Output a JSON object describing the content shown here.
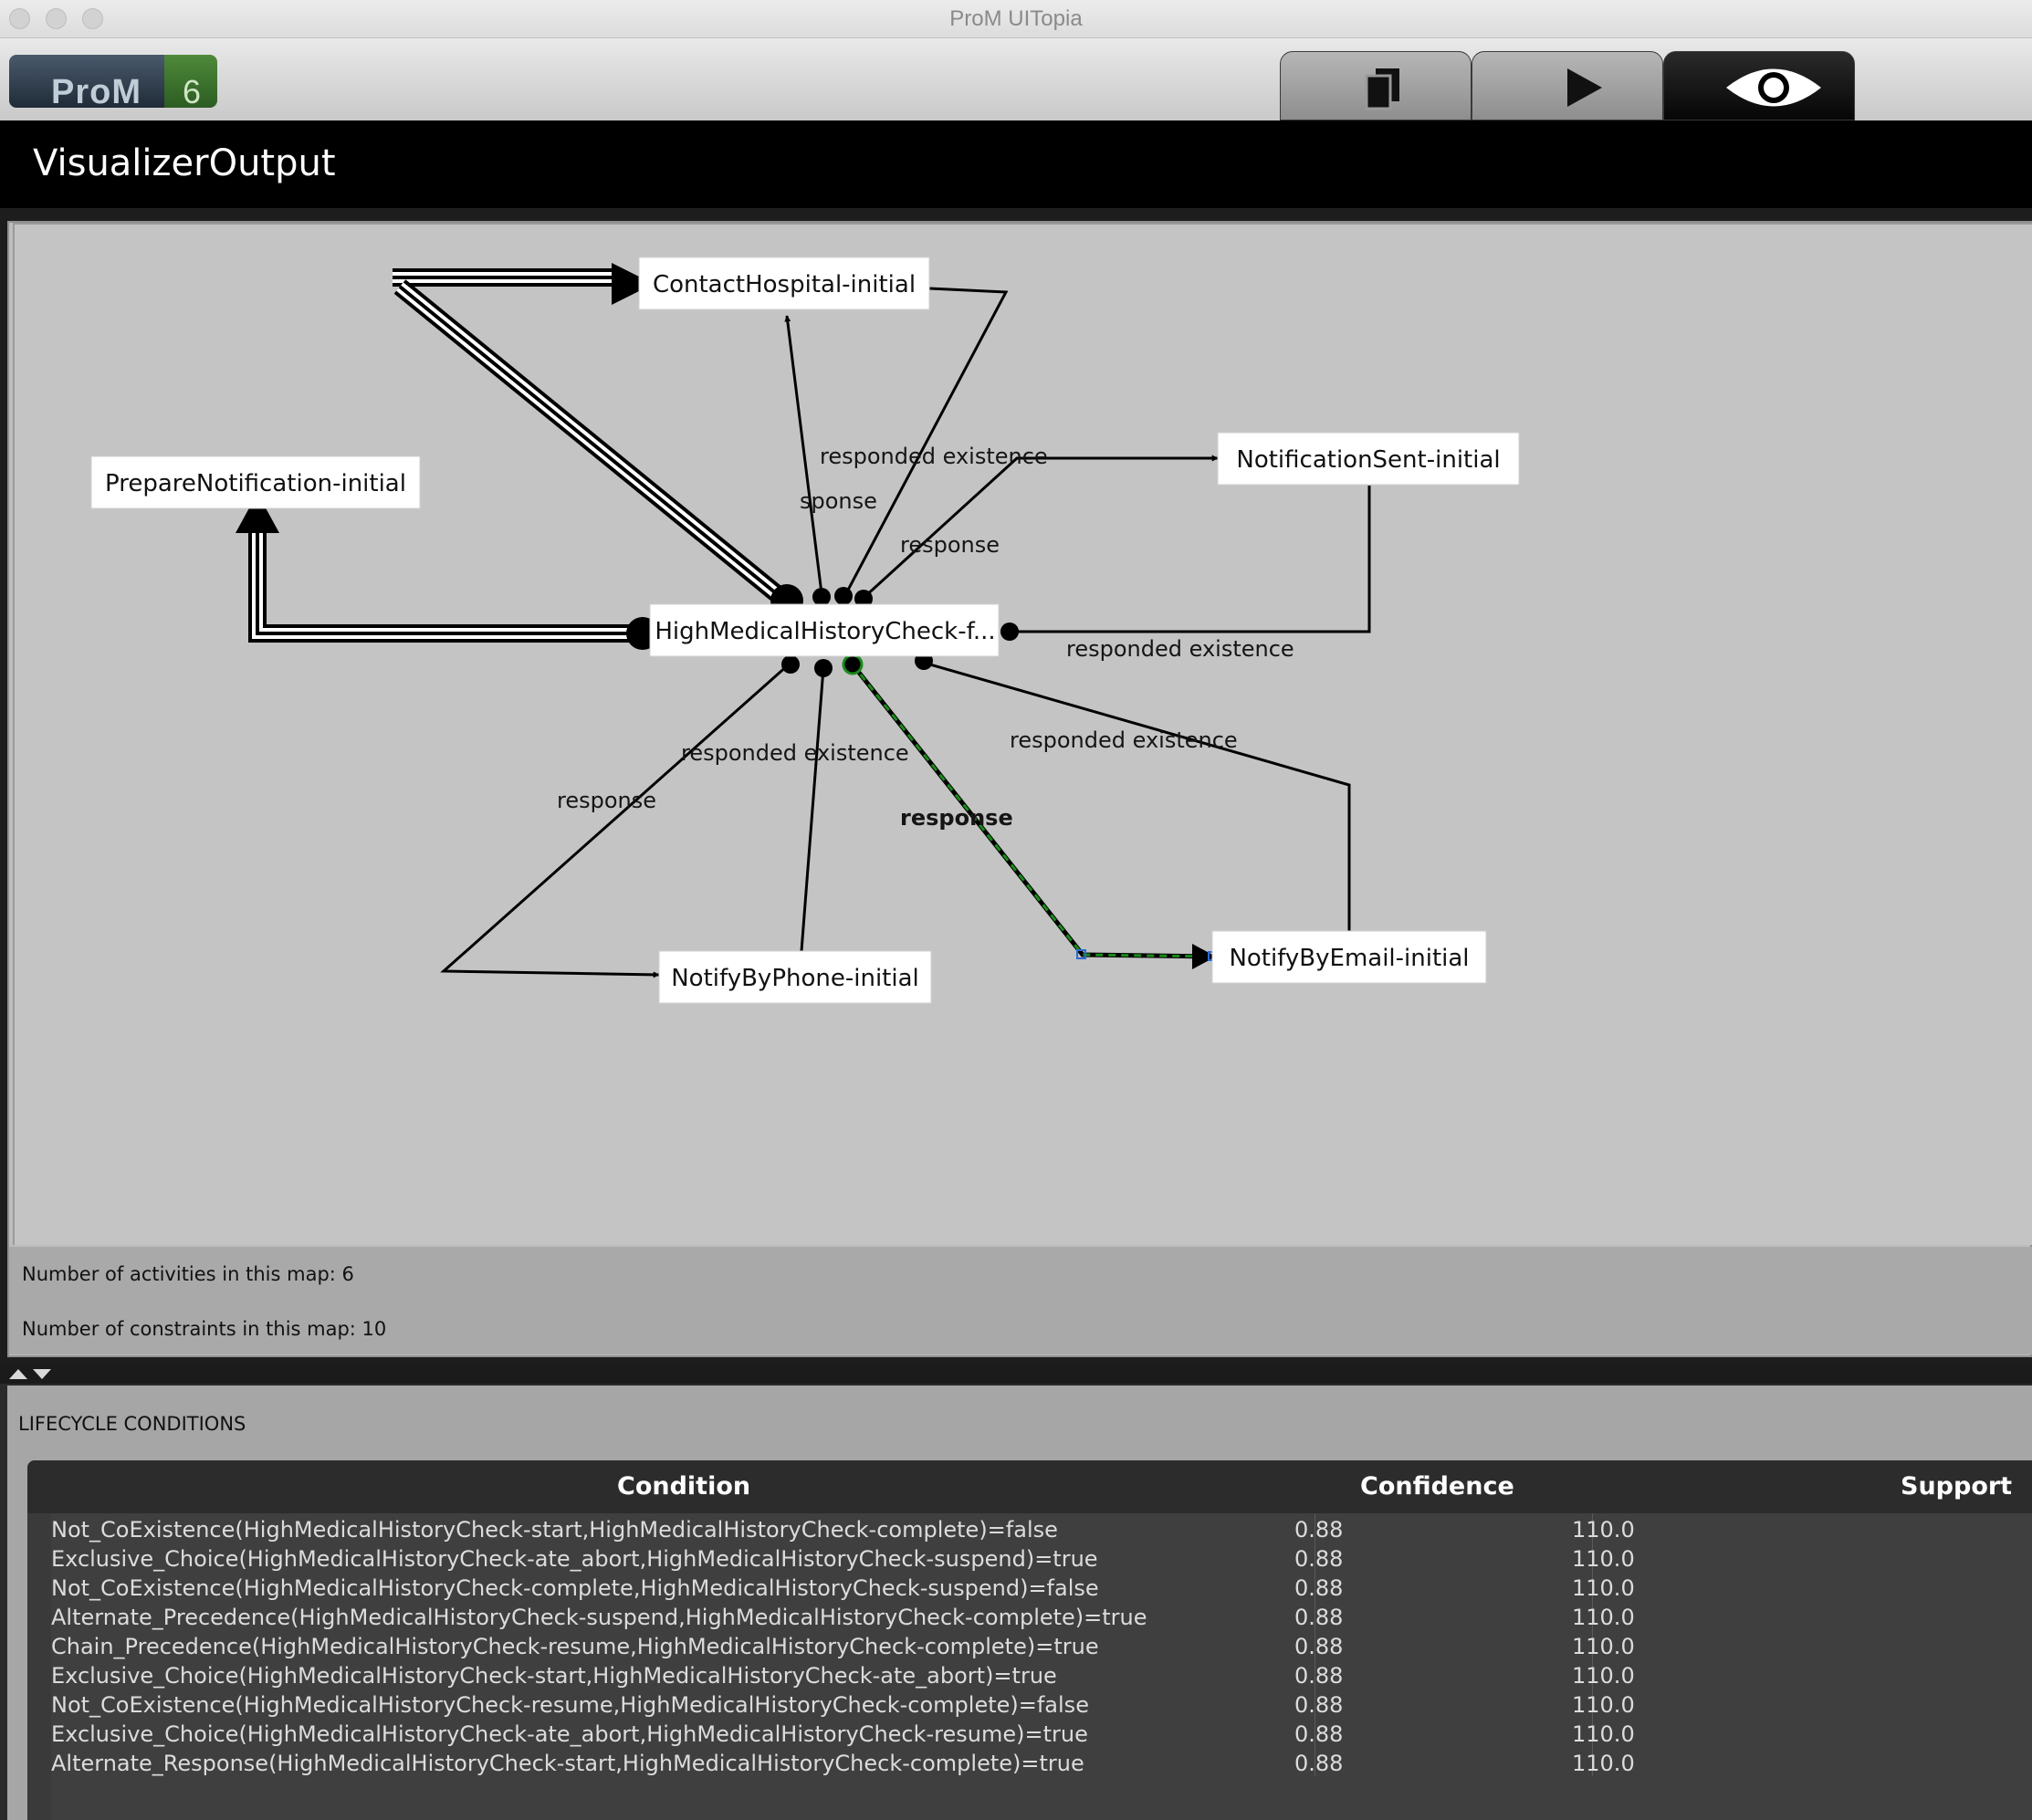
{
  "window": {
    "title": "ProM UITopia"
  },
  "logo": {
    "text": "ProM",
    "version": "6"
  },
  "tabs": [
    {
      "icon": "workspace-icon",
      "label": "Workspace"
    },
    {
      "icon": "play-icon",
      "label": "Actions"
    },
    {
      "icon": "eye-icon",
      "label": "Views",
      "active": true
    }
  ],
  "view": {
    "title": "VisualizerOutput"
  },
  "graph": {
    "nodes": {
      "contact_hospital": "ContactHospital-initial",
      "prepare_notification": "PrepareNotification-initial",
      "notification_sent": "NotificationSent-initial",
      "high_medical": "HighMedicalHistoryCheck-f...",
      "notify_phone": "NotifyByPhone-initial",
      "notify_email": "NotifyByEmail-initial"
    },
    "edge_labels": {
      "responded_existence_top": "responded existence",
      "sponse_top": "sponse",
      "response_top": "response",
      "responded_existence_right": "responded existence",
      "responded_existence_mid": "responded existence",
      "responded_existence_lowright": "responded existence",
      "response_left": "response",
      "response_email": "response"
    },
    "highlight_color": "#1a8a1a"
  },
  "info": {
    "activities": "Number of activities in this map: 6",
    "constraints": "Number of constraints in this map: 10"
  },
  "lifecycle": {
    "title": "LIFECYCLE CONDITIONS",
    "columns": [
      "Condition",
      "Confidence",
      "Support"
    ],
    "rows": [
      [
        "Not_CoExistence(HighMedicalHistoryCheck-start,HighMedicalHistoryCheck-complete)=false",
        "0.88",
        "110.0"
      ],
      [
        "Exclusive_Choice(HighMedicalHistoryCheck-ate_abort,HighMedicalHistoryCheck-suspend)=true",
        "0.88",
        "110.0"
      ],
      [
        "Not_CoExistence(HighMedicalHistoryCheck-complete,HighMedicalHistoryCheck-suspend)=false",
        "0.88",
        "110.0"
      ],
      [
        "Alternate_Precedence(HighMedicalHistoryCheck-suspend,HighMedicalHistoryCheck-complete)=true",
        "0.88",
        "110.0"
      ],
      [
        "Chain_Precedence(HighMedicalHistoryCheck-resume,HighMedicalHistoryCheck-complete)=true",
        "0.88",
        "110.0"
      ],
      [
        "Exclusive_Choice(HighMedicalHistoryCheck-start,HighMedicalHistoryCheck-ate_abort)=true",
        "0.88",
        "110.0"
      ],
      [
        "Not_CoExistence(HighMedicalHistoryCheck-resume,HighMedicalHistoryCheck-complete)=false",
        "0.88",
        "110.0"
      ],
      [
        "Exclusive_Choice(HighMedicalHistoryCheck-ate_abort,HighMedicalHistoryCheck-resume)=true",
        "0.88",
        "110.0"
      ],
      [
        "Alternate_Response(HighMedicalHistoryCheck-start,HighMedicalHistoryCheck-complete)=true",
        "0.88",
        "110.0"
      ]
    ]
  }
}
